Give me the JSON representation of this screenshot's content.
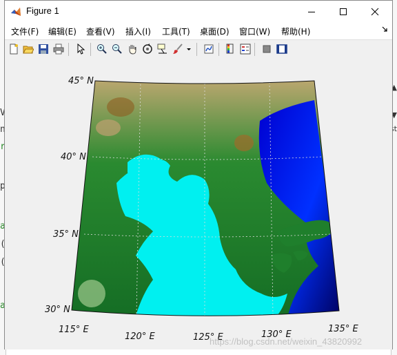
{
  "window": {
    "title": "Figure 1"
  },
  "menu": [
    {
      "label": "文件(F)"
    },
    {
      "label": "编辑(E)"
    },
    {
      "label": "查看(V)"
    },
    {
      "label": "插入(I)"
    },
    {
      "label": "工具(T)"
    },
    {
      "label": "桌面(D)"
    },
    {
      "label": "窗口(W)"
    },
    {
      "label": "帮助(H)"
    }
  ],
  "toolbar_icons": [
    "new-figure-icon",
    "open-folder-icon",
    "save-icon",
    "print-icon",
    "pointer-icon",
    "zoom-in-icon",
    "zoom-out-icon",
    "pan-hand-icon",
    "rotate-3d-icon",
    "data-cursor-icon",
    "brush-icon",
    "brush-dropdown-icon",
    "link-plot-icon",
    "colorbar-icon",
    "legend-icon",
    "hide-plot-tools-icon",
    "show-plot-tools-icon"
  ],
  "map": {
    "lat_labels": [
      "45° N",
      "40° N",
      "35° N",
      "30° N"
    ],
    "lon_labels": [
      "115° E",
      "120° E",
      "125° E",
      "130° E",
      "135° E"
    ],
    "colors": {
      "ocean_deep": "#00007a",
      "ocean_shallow": "#00f0f0",
      "land_low": "#1a7a2a",
      "land_high": "#a07830"
    }
  },
  "watermark": "https://blog.csdn.net/weixin_43820992",
  "background_text": {
    "left": [
      "r",
      "V",
      "n",
      "p",
      "a",
      "(",
      "(",
      "a"
    ],
    "right": [
      "▲",
      "▼",
      "st"
    ]
  }
}
